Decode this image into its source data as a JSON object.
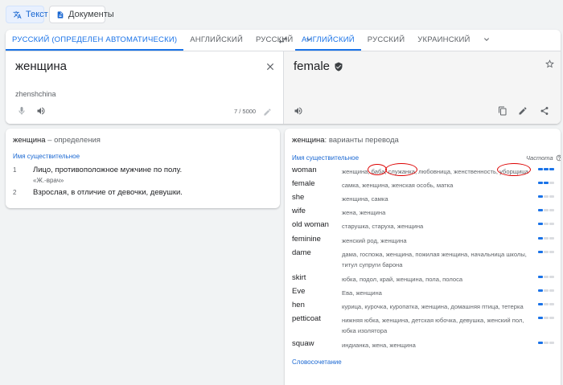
{
  "mode_tabs": {
    "text": "Текст",
    "documents": "Документы"
  },
  "source_langs": [
    "РУССКИЙ (ОПРЕДЕЛЕН АВТОМАТИЧЕСКИ)",
    "АНГЛИЙСКИЙ",
    "РУССКИЙ"
  ],
  "target_langs": [
    "АНГЛИЙСКИЙ",
    "РУССКИЙ",
    "УКРАИНСКИЙ"
  ],
  "source": {
    "text": "женщина",
    "transliteration": "zhenshchina",
    "char_count": "7 / 5000"
  },
  "target": {
    "text": "female"
  },
  "definitions": {
    "word": "женщина",
    "suffix": " – определения",
    "pos": "Имя существительное",
    "items": [
      {
        "num": "1",
        "text": "Лицо, противоположное мужчине по полу.",
        "example": "«Ж.-врач»"
      },
      {
        "num": "2",
        "text": "Взрослая, в отличие от девочки, девушки.",
        "example": ""
      }
    ]
  },
  "translations": {
    "word": "женщина",
    "suffix": ": варианты перевода",
    "pos": "Имя существительное",
    "freq_label": "Частота",
    "combo_link": "Словосочетание",
    "rows": [
      {
        "word": "woman",
        "syn": "женщина, баба, служанка, любовница, женственность, уборщица",
        "freq": 3
      },
      {
        "word": "female",
        "syn": "самка, женщина, женская особь, матка",
        "freq": 2
      },
      {
        "word": "she",
        "syn": "женщина, самка",
        "freq": 1
      },
      {
        "word": "wife",
        "syn": "жена, женщина",
        "freq": 1
      },
      {
        "word": "old woman",
        "syn": "старушка, старуха, женщина",
        "freq": 1
      },
      {
        "word": "feminine",
        "syn": "женский род, женщина",
        "freq": 1
      },
      {
        "word": "dame",
        "syn": "дама, госпожа, женщина, пожилая женщина, начальница школы, титул супруги барона",
        "freq": 1
      },
      {
        "word": "skirt",
        "syn": "юбка, подол, край, женщина, пола, полоса",
        "freq": 1
      },
      {
        "word": "Eve",
        "syn": "Ева, женщина",
        "freq": 1
      },
      {
        "word": "hen",
        "syn": "курица, курочка, куропатка, женщина, домашняя птица, тетерка",
        "freq": 1
      },
      {
        "word": "petticoat",
        "syn": "нижняя юбка, женщина, детская юбочка, девушка, женский пол, юбка изолятора",
        "freq": 1
      },
      {
        "word": "squaw",
        "syn": "индианка, жена, женщина",
        "freq": 1
      }
    ]
  },
  "colors": {
    "accent": "#1a73e8",
    "annotation": "#dd0000"
  }
}
